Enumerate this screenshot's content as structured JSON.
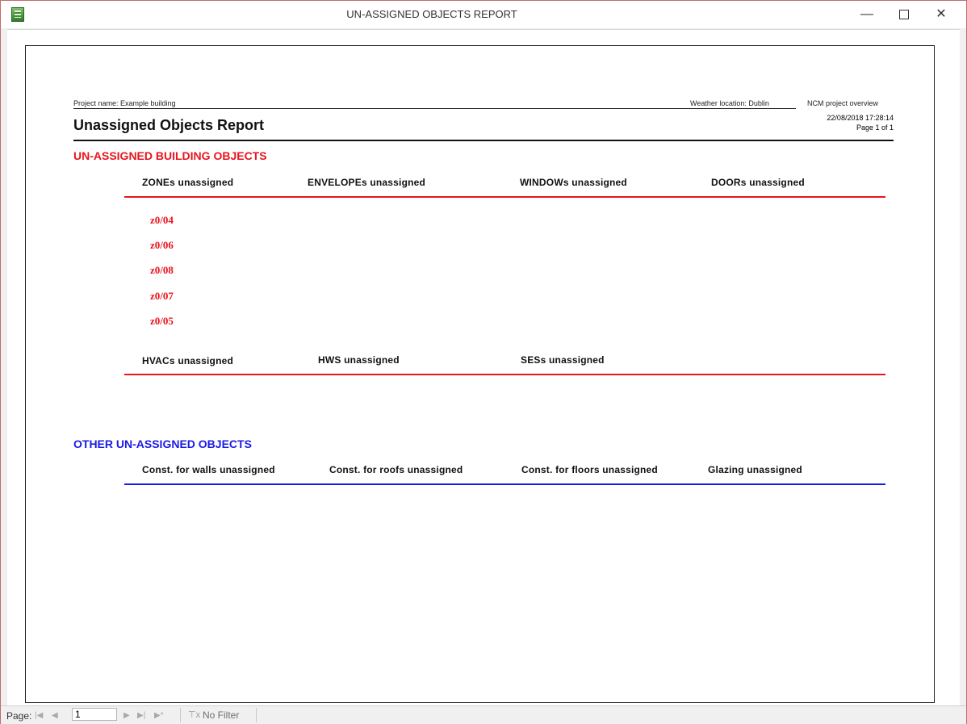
{
  "window": {
    "title": "UN-ASSIGNED OBJECTS REPORT",
    "minimize": "—",
    "close": "✕"
  },
  "report": {
    "project_name_label": "Project name:  Example building",
    "weather_label": "Weather location:  Dublin",
    "overview_label": "NCM project overview",
    "title": "Unassigned Objects Report",
    "datetime": "22/08/2018 17:28:14",
    "page_info": "Page 1 of 1",
    "section1": {
      "heading": "UN-ASSIGNED BUILDING OBJECTS",
      "columns_row1": [
        "ZONEs unassigned",
        "ENVELOPEs unassigned",
        "WINDOWs unassigned",
        "DOORs unassigned"
      ],
      "zones": [
        "z0/04",
        "z0/06",
        "z0/08",
        "z0/07",
        "z0/05"
      ],
      "columns_row2": [
        "HVACs unassigned",
        "HWS unassigned",
        "SESs unassigned"
      ]
    },
    "section2": {
      "heading": "OTHER UN-ASSIGNED OBJECTS",
      "columns": [
        "Const. for walls unassigned",
        "Const. for roofs unassigned",
        "Const. for floors unassigned",
        "Glazing unassigned"
      ]
    }
  },
  "statusbar": {
    "page_label": "Page:",
    "page_value": "1",
    "filter_label": "No Filter"
  },
  "colors": {
    "red": "#e8141e",
    "blue": "#1a1ae6"
  }
}
